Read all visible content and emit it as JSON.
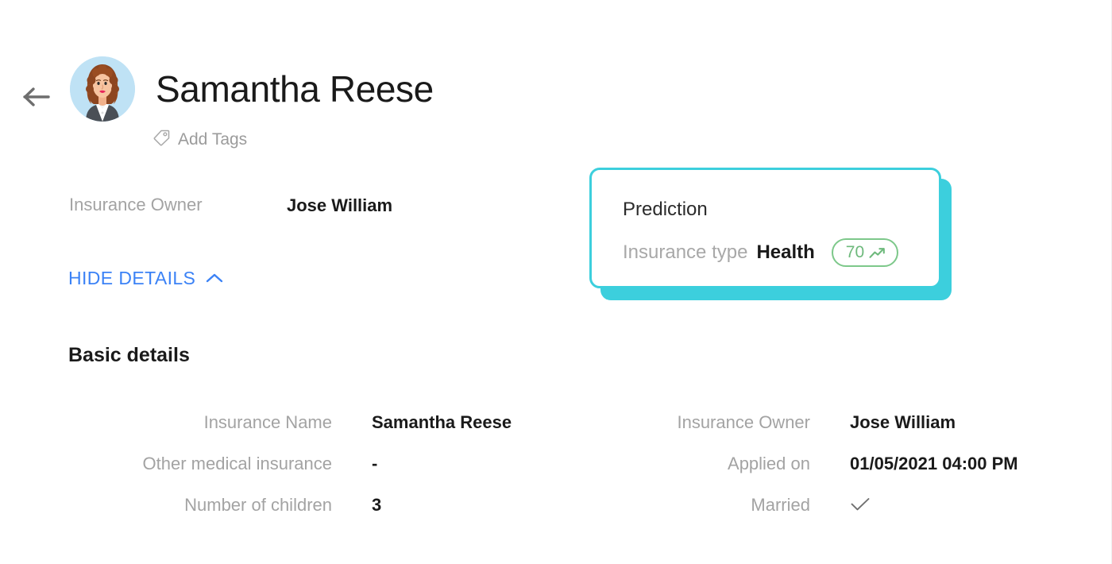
{
  "header": {
    "back_icon": "arrow-left-icon",
    "avatar": "user-avatar-illustration",
    "name": "Samantha Reese",
    "tags": {
      "icon": "tag-icon",
      "label": "Add Tags"
    }
  },
  "summary": {
    "owner_label": "Insurance Owner",
    "owner_value": "Jose William"
  },
  "toggle": {
    "label": "HIDE DETAILS",
    "icon": "chevron-up-icon",
    "color": "#3b82f6"
  },
  "prediction": {
    "title": "Prediction",
    "field_label": "Insurance type",
    "field_value": "Health",
    "score": "70",
    "score_icon": "trend-up-icon",
    "accent_color": "#3ccfdd",
    "score_color": "#6eb97c"
  },
  "section": {
    "title": "Basic details"
  },
  "details": {
    "left": [
      {
        "label": "Insurance Name",
        "value": "Samantha Reese",
        "type": "text"
      },
      {
        "label": "Other medical insurance",
        "value": "-",
        "type": "text"
      },
      {
        "label": "Number of children",
        "value": "3",
        "type": "text"
      }
    ],
    "right": [
      {
        "label": "Insurance Owner",
        "value": "Jose William",
        "type": "text"
      },
      {
        "label": "Applied on",
        "value": "01/05/2021 04:00 PM",
        "type": "text"
      },
      {
        "label": "Married",
        "value": "",
        "type": "check",
        "icon": "check-icon"
      }
    ]
  }
}
